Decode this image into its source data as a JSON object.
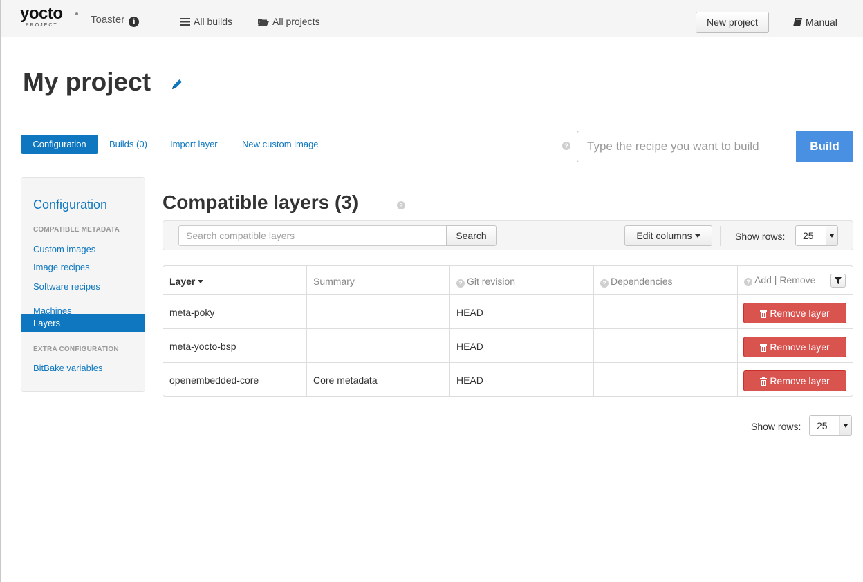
{
  "navbar": {
    "logo_main": "yocto",
    "logo_sub": "PROJECT",
    "app_name": "Toaster",
    "all_builds": "All builds",
    "all_projects": "All projects",
    "new_project": "New project",
    "manual": "Manual"
  },
  "page": {
    "title": "My project"
  },
  "tabs": {
    "configuration": "Configuration",
    "builds": "Builds (0)",
    "import_layer": "Import layer",
    "new_custom_image": "New custom image"
  },
  "build": {
    "placeholder": "Type the recipe you want to build",
    "button": "Build"
  },
  "sidebar": {
    "heading": "Configuration",
    "section_compatible": "COMPATIBLE METADATA",
    "items": [
      "Custom images",
      "Image recipes",
      "Software recipes",
      "Machines",
      "Layers"
    ],
    "section_extra": "EXTRA CONFIGURATION",
    "extra_items": [
      "BitBake variables"
    ]
  },
  "layers": {
    "title": "Compatible layers (3)",
    "search_placeholder": "Search compatible layers",
    "search_button": "Search",
    "edit_columns": "Edit columns",
    "show_rows_label": "Show rows:",
    "show_rows_value": "25",
    "columns": [
      "Layer",
      "Summary",
      "Git revision",
      "Dependencies",
      "Add | Remove"
    ],
    "rows": [
      {
        "layer": "meta-poky",
        "summary": "",
        "git_revision": "HEAD",
        "dependencies": "",
        "action": "Remove layer"
      },
      {
        "layer": "meta-yocto-bsp",
        "summary": "",
        "git_revision": "HEAD",
        "dependencies": "",
        "action": "Remove layer"
      },
      {
        "layer": "openembedded-core",
        "summary": "Core metadata",
        "git_revision": "HEAD",
        "dependencies": "",
        "action": "Remove layer"
      }
    ]
  },
  "colors": {
    "link_blue": "#0e77c0",
    "build_blue": "#4a90e2",
    "danger_red": "#d9534f"
  }
}
